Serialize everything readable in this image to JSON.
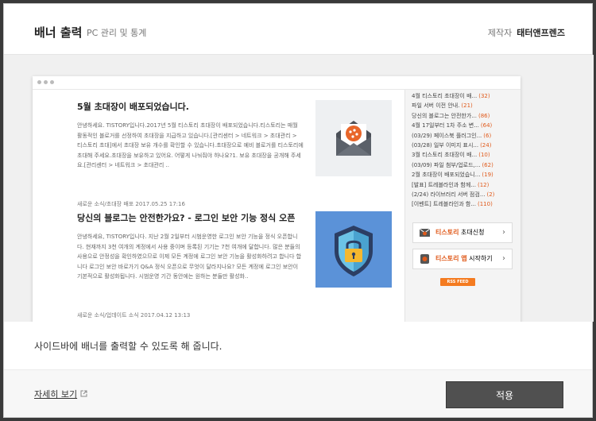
{
  "header": {
    "title": "배너 출력",
    "subtitle": "PC 관리 및 통계",
    "maker_label": "제작자",
    "maker_name": "태터앤프렌즈"
  },
  "preview": {
    "posts": [
      {
        "title": "5월 초대장이 배포되었습니다.",
        "body": "안녕하세요. TISTORY입니다.2017년 5월 티스토리 초대장이 배포되었습니다.티스토리는 매월 활동적인 블로거를 선정하여 초대장을 지급하고 있습니다.[관리센터 > 네트워크 > 초대관리 > 티스토리 초대]에서 초대장 보유 개수를 확인할 수 있습니다.초대장으로 예비 블로거를 티스토리에 초대해 주세요.초대장을 보유하고 있어요. 어떻게 나눠줘야 하나요?1. 보유 초대장을 공개해 주세요.[관리센터 > 네트워크 > 초대관리 ..",
        "meta": "새로운 소식/초대장 배포   2017.05.25 17:16"
      },
      {
        "title": "당신의 블로그는 안전한가요? - 로그인 보안 기능 정식 오픈",
        "body": "안녕하세요, TISTORY입니다. 지난 2월 2일부터 시범운영한 로그인 보안 기능을 정식 오픈합니다. 현재까지 3천 여개의 계정에서 사용 중이며 등록된 기기는 7천 여개에 달합니다. 많은 분들의 사용으로 안정성을 확인하였으므로 이제 모든 계정에 로그인 보안 기능을 활성화하려고 합니다 합니다 로그인 보안 바로가기 Q&A 정식 오픈으로 무엇이 달라지나요? 모든 계정에 로그인 보안이 기본적으로 활성화됩니다. 시범운영 기간 동안에는 원하는 분들만 활성화..",
        "meta": "새로운 소식/업데이트 소식   2017.04.12 13:13"
      }
    ],
    "sidebar_items": [
      {
        "text": "4월 티스토리 초대장이 배...",
        "count": "(32)"
      },
      {
        "text": "파일 서버 이전 안내.",
        "count": "(21)"
      },
      {
        "text": "당신의 블로그는 안전한가...",
        "count": "(86)"
      },
      {
        "text": "4월 17일부터 1차 주소 변...",
        "count": "(64)"
      },
      {
        "text": "(03/29) 페이스북 플러그인...",
        "count": "(6)"
      },
      {
        "text": "(03/28) 일부 이미지 표시...",
        "count": "(24)"
      },
      {
        "text": "3월 티스토리 초대장이 배...",
        "count": "(10)"
      },
      {
        "text": "(03/09) 파일 첨부/업로드,...",
        "count": "(62)"
      },
      {
        "text": "2월 초대장이 배포되었습니...",
        "count": "(19)"
      },
      {
        "text": "[발표] 트레블라인과 함께...",
        "count": "(12)"
      },
      {
        "text": "(2/24) 라이브러리 서버 점검...",
        "count": "(2)"
      },
      {
        "text": "[이벤트] 트레블라인과 함...",
        "count": "(110)"
      }
    ],
    "invite_button": {
      "brand": "티스토리",
      "rest": " 초대신청"
    },
    "app_button": {
      "brand": "티스토리 앱",
      "rest": " 시작하기"
    },
    "rss_label": "RSS FEED"
  },
  "description": "사이드바에 배너를 출력할 수 있도록 해 줍니다.",
  "footer": {
    "detail_link": "자세히 보기",
    "apply_label": "적용"
  },
  "colors": {
    "accent": "#e05a1b",
    "apply_bg": "#505050",
    "shield_bg": "#5b92d8"
  }
}
